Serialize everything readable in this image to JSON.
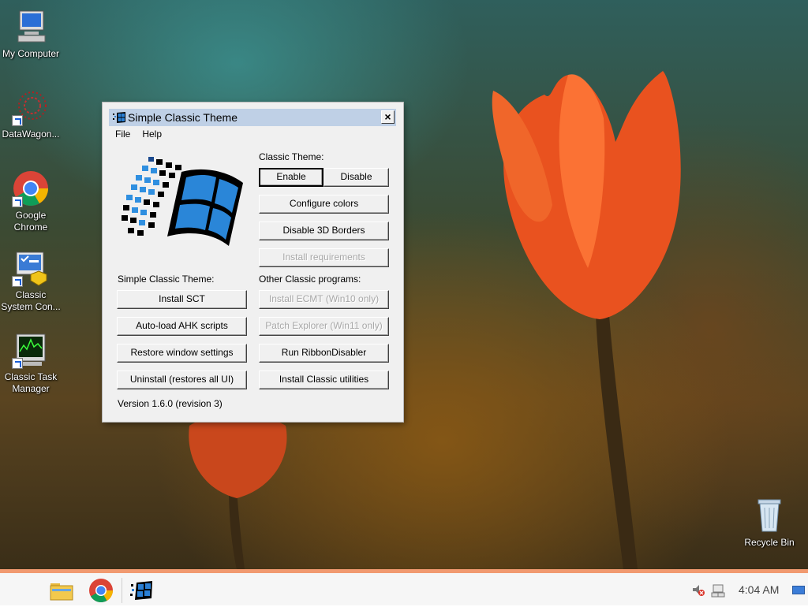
{
  "desktop": {
    "icons": [
      {
        "label": "My Computer"
      },
      {
        "label": "DataWagon..."
      },
      {
        "label": "Google Chrome"
      },
      {
        "label": "Classic System Con..."
      },
      {
        "label": "Classic Task Manager"
      },
      {
        "label": "Recycle Bin"
      }
    ]
  },
  "dialog": {
    "title": "Simple Classic Theme",
    "close_label": "×",
    "menu": [
      "File",
      "Help"
    ],
    "classic_theme_label": "Classic Theme:",
    "enable_label": "Enable",
    "disable_label": "Disable",
    "configure_colors_label": "Configure colors",
    "disable_3d_label": "Disable 3D Borders",
    "install_requirements_label": "Install requirements",
    "sct_section_label": "Simple Classic Theme:",
    "other_section_label": "Other Classic programs:",
    "install_sct_label": "Install SCT",
    "autoload_label": "Auto-load AHK scripts",
    "restore_label": "Restore window settings",
    "uninstall_label": "Uninstall (restores all UI)",
    "install_ecmt_label": "Install ECMT (Win10 only)",
    "patch_explorer_label": "Patch Explorer (Win11 only)",
    "ribbon_label": "Run RibbonDisabler",
    "utilities_label": "Install Classic utilities",
    "version_label": "Version 1.6.0 (revision 3)"
  },
  "taskbar": {
    "clock": "4:04 AM",
    "accent_color": "#f19a70"
  }
}
